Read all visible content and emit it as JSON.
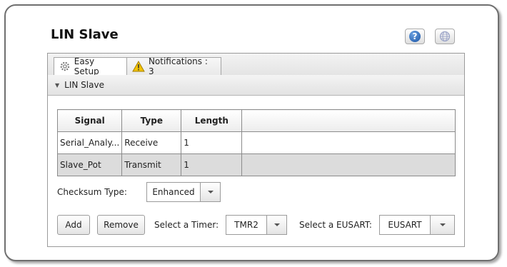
{
  "header": {
    "title": "LIN Slave"
  },
  "tabs": [
    {
      "label": "Easy Setup",
      "icon": "gear-icon"
    },
    {
      "label": "Notifications : 3",
      "icon": "warning-icon"
    }
  ],
  "section": {
    "label": "LIN Slave"
  },
  "table": {
    "columns": [
      "Signal",
      "Type",
      "Length"
    ],
    "rows": [
      {
        "signal": "Serial_Analy...",
        "type": "Receive",
        "length": "1"
      },
      {
        "signal": "Slave_Pot",
        "type": "Transmit",
        "length": "1"
      }
    ]
  },
  "checksum": {
    "label": "Checksum Type:",
    "value": "Enhanced"
  },
  "actions": {
    "add": "Add",
    "remove": "Remove"
  },
  "timer": {
    "label": "Select a Timer:",
    "value": "TMR2"
  },
  "eusart": {
    "label": "Select a EUSART:",
    "value": "EUSART"
  },
  "colors": {
    "help_blue": "#1d56a6",
    "warning_yellow": "#f2c200",
    "selected_row": "#dcdcdc"
  }
}
